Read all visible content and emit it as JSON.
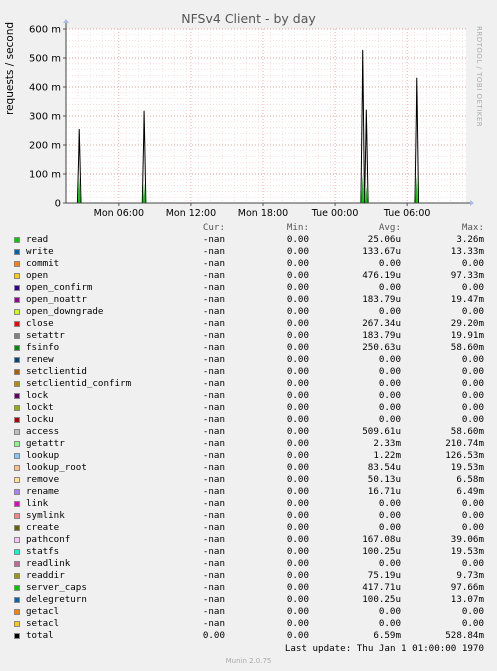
{
  "chart_data": {
    "type": "line",
    "title": "NFSv4 Client - by day",
    "ylabel": "requests / second",
    "xlabel": "",
    "ylim": [
      0,
      600
    ],
    "yticks": [
      {
        "value": 0,
        "label": "0"
      },
      {
        "value": 100,
        "label": "100 m"
      },
      {
        "value": 200,
        "label": "200 m"
      },
      {
        "value": 300,
        "label": "300 m"
      },
      {
        "value": 400,
        "label": "400 m"
      },
      {
        "value": 500,
        "label": "500 m"
      },
      {
        "value": 600,
        "label": "600 m"
      }
    ],
    "xticks": [
      "Mon 06:00",
      "Mon 12:00",
      "Mon 18:00",
      "Tue 00:00",
      "Tue 06:00"
    ],
    "grid": true,
    "spikes": [
      {
        "at_hour": 1.1,
        "total": 255,
        "green": 90
      },
      {
        "at_hour": 6.5,
        "total": 318,
        "green": 70
      },
      {
        "at_hour": 24.7,
        "total": 528,
        "green": 100
      },
      {
        "at_hour": 25.0,
        "total": 322,
        "green": 60
      },
      {
        "at_hour": 29.2,
        "total": 432,
        "green": 95
      }
    ]
  },
  "side_label": "RRDTOOL / TOBI OETIKER",
  "legend": {
    "headers": {
      "cur": "Cur:",
      "min": "Min:",
      "avg": "Avg:",
      "max": "Max:"
    },
    "rows": [
      {
        "name": "read",
        "color": "#00cc00",
        "cur": "-nan",
        "min": "0.00",
        "avg": "25.06u",
        "max": "3.26m"
      },
      {
        "name": "write",
        "color": "#0066b3",
        "cur": "-nan",
        "min": "0.00",
        "avg": "133.67u",
        "max": "13.33m"
      },
      {
        "name": "commit",
        "color": "#ff8000",
        "cur": "-nan",
        "min": "0.00",
        "avg": "0.00",
        "max": "0.00"
      },
      {
        "name": "open",
        "color": "#ffcc00",
        "cur": "-nan",
        "min": "0.00",
        "avg": "476.19u",
        "max": "97.33m"
      },
      {
        "name": "open_confirm",
        "color": "#330099",
        "cur": "-nan",
        "min": "0.00",
        "avg": "0.00",
        "max": "0.00"
      },
      {
        "name": "open_noattr",
        "color": "#990099",
        "cur": "-nan",
        "min": "0.00",
        "avg": "183.79u",
        "max": "19.47m"
      },
      {
        "name": "open_downgrade",
        "color": "#ccff00",
        "cur": "-nan",
        "min": "0.00",
        "avg": "0.00",
        "max": "0.00"
      },
      {
        "name": "close",
        "color": "#ff0000",
        "cur": "-nan",
        "min": "0.00",
        "avg": "267.34u",
        "max": "29.20m"
      },
      {
        "name": "setattr",
        "color": "#808080",
        "cur": "-nan",
        "min": "0.00",
        "avg": "183.79u",
        "max": "19.91m"
      },
      {
        "name": "fsinfo",
        "color": "#008f00",
        "cur": "-nan",
        "min": "0.00",
        "avg": "250.63u",
        "max": "58.60m"
      },
      {
        "name": "renew",
        "color": "#00487d",
        "cur": "-nan",
        "min": "0.00",
        "avg": "0.00",
        "max": "0.00"
      },
      {
        "name": "setclientid",
        "color": "#b35a00",
        "cur": "-nan",
        "min": "0.00",
        "avg": "0.00",
        "max": "0.00"
      },
      {
        "name": "setclientid_confirm",
        "color": "#b38f00",
        "cur": "-nan",
        "min": "0.00",
        "avg": "0.00",
        "max": "0.00"
      },
      {
        "name": "lock",
        "color": "#6b006b",
        "cur": "-nan",
        "min": "0.00",
        "avg": "0.00",
        "max": "0.00"
      },
      {
        "name": "lockt",
        "color": "#8fb300",
        "cur": "-nan",
        "min": "0.00",
        "avg": "0.00",
        "max": "0.00"
      },
      {
        "name": "locku",
        "color": "#b30000",
        "cur": "-nan",
        "min": "0.00",
        "avg": "0.00",
        "max": "0.00"
      },
      {
        "name": "access",
        "color": "#bebebe",
        "cur": "-nan",
        "min": "0.00",
        "avg": "509.61u",
        "max": "58.60m"
      },
      {
        "name": "getattr",
        "color": "#80ff80",
        "cur": "-nan",
        "min": "0.00",
        "avg": "2.33m",
        "max": "210.74m"
      },
      {
        "name": "lookup",
        "color": "#80c9ff",
        "cur": "-nan",
        "min": "0.00",
        "avg": "1.22m",
        "max": "126.53m"
      },
      {
        "name": "lookup_root",
        "color": "#ffc080",
        "cur": "-nan",
        "min": "0.00",
        "avg": "83.54u",
        "max": "19.53m"
      },
      {
        "name": "remove",
        "color": "#ffe680",
        "cur": "-nan",
        "min": "0.00",
        "avg": "50.13u",
        "max": "6.58m"
      },
      {
        "name": "rename",
        "color": "#aa80ff",
        "cur": "-nan",
        "min": "0.00",
        "avg": "16.71u",
        "max": "6.49m"
      },
      {
        "name": "link",
        "color": "#ee00cc",
        "cur": "-nan",
        "min": "0.00",
        "avg": "0.00",
        "max": "0.00"
      },
      {
        "name": "symlink",
        "color": "#ff8080",
        "cur": "-nan",
        "min": "0.00",
        "avg": "0.00",
        "max": "0.00"
      },
      {
        "name": "create",
        "color": "#666600",
        "cur": "-nan",
        "min": "0.00",
        "avg": "0.00",
        "max": "0.00"
      },
      {
        "name": "pathconf",
        "color": "#ffbfff",
        "cur": "-nan",
        "min": "0.00",
        "avg": "167.08u",
        "max": "39.06m"
      },
      {
        "name": "statfs",
        "color": "#00ffcc",
        "cur": "-nan",
        "min": "0.00",
        "avg": "100.25u",
        "max": "19.53m"
      },
      {
        "name": "readlink",
        "color": "#cc6699",
        "cur": "-nan",
        "min": "0.00",
        "avg": "0.00",
        "max": "0.00"
      },
      {
        "name": "readdir",
        "color": "#999900",
        "cur": "-nan",
        "min": "0.00",
        "avg": "75.19u",
        "max": "9.73m"
      },
      {
        "name": "server_caps",
        "color": "#00cc00",
        "cur": "-nan",
        "min": "0.00",
        "avg": "417.71u",
        "max": "97.66m"
      },
      {
        "name": "delegreturn",
        "color": "#0066b3",
        "cur": "-nan",
        "min": "0.00",
        "avg": "100.25u",
        "max": "13.07m"
      },
      {
        "name": "getacl",
        "color": "#ff8000",
        "cur": "-nan",
        "min": "0.00",
        "avg": "0.00",
        "max": "0.00"
      },
      {
        "name": "setacl",
        "color": "#ffcc00",
        "cur": "-nan",
        "min": "0.00",
        "avg": "0.00",
        "max": "0.00"
      },
      {
        "name": "total",
        "color": "#000000",
        "cur": "0.00",
        "min": "0.00",
        "avg": "6.59m",
        "max": "528.84m"
      }
    ]
  },
  "footer": {
    "last_update": "Last update: Thu Jan  1 01:00:00 1970",
    "munin": "Munin 2.0.75"
  }
}
